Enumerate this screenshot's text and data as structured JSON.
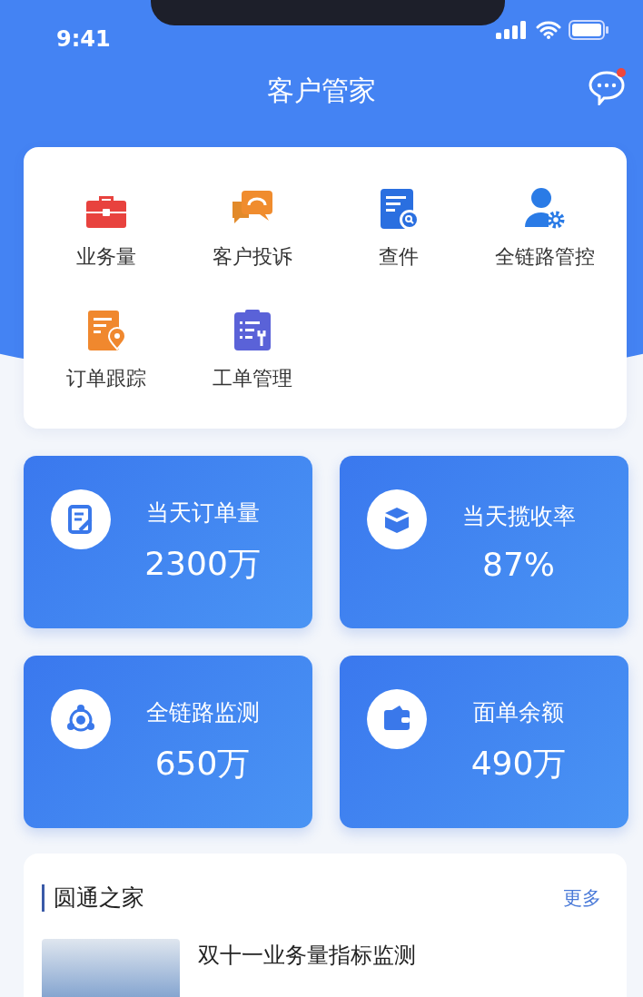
{
  "status_bar": {
    "time": "9:41"
  },
  "header": {
    "title": "客户管家",
    "messages_unread": true
  },
  "menu": [
    {
      "label": "业务量",
      "kind": "briefcase"
    },
    {
      "label": "客户投诉",
      "kind": "chat"
    },
    {
      "label": "查件",
      "kind": "search-doc"
    },
    {
      "label": "全链路管控",
      "kind": "user-gear"
    },
    {
      "label": "订单跟踪",
      "kind": "doc-pin"
    },
    {
      "label": "工单管理",
      "kind": "clipboard-tool"
    }
  ],
  "stats": [
    {
      "label": "当天订单量",
      "value": "2300万",
      "kind": "note"
    },
    {
      "label": "当天揽收率",
      "value": "87%",
      "kind": "box"
    },
    {
      "label": "全链路监测",
      "value": "650万",
      "kind": "network"
    },
    {
      "label": "面单余额",
      "value": "490万",
      "kind": "wallet"
    }
  ],
  "news": {
    "title": "圆通之家",
    "more": "更多",
    "items": [
      {
        "title": "双十一业务量指标监测"
      }
    ]
  }
}
